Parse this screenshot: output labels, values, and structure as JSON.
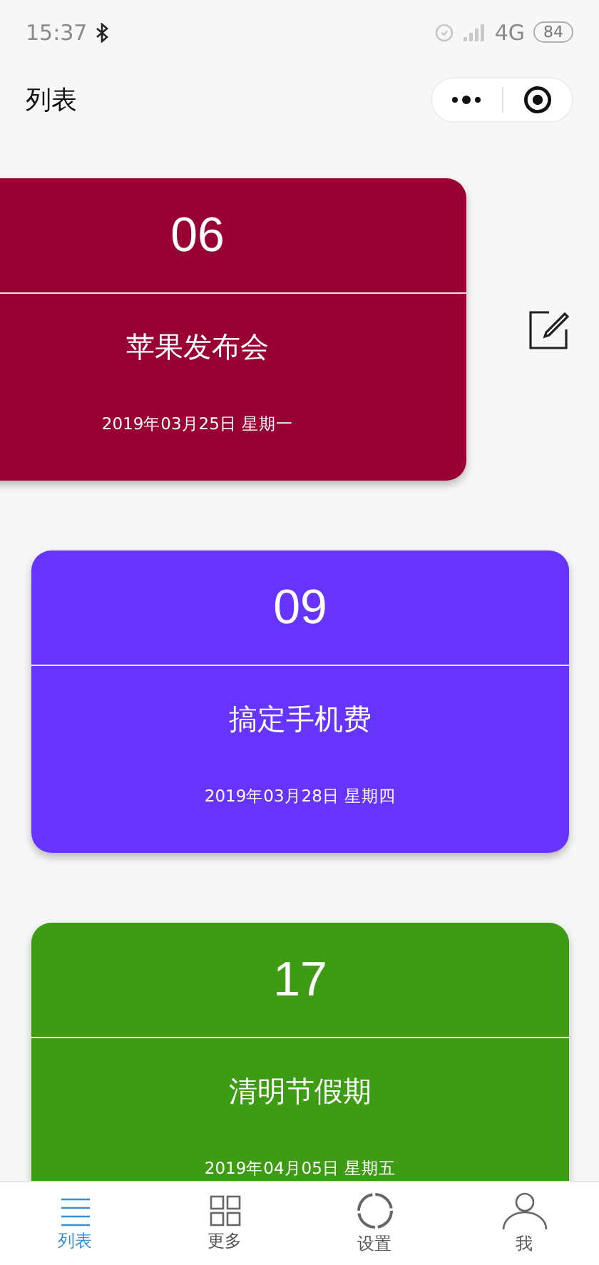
{
  "status_bar": {
    "time": "15:37",
    "network": "4G",
    "battery": "84"
  },
  "header": {
    "title": "列表"
  },
  "cards": [
    {
      "number": "06",
      "title": "苹果发布会",
      "date": "2019年03月25日 星期一",
      "color": "#990033",
      "swiped": true
    },
    {
      "number": "09",
      "title": "搞定手机费",
      "date": "2019年03月28日 星期四",
      "color": "#6633ff",
      "swiped": false
    },
    {
      "number": "17",
      "title": "清明节假期",
      "date": "2019年04月05日 星期五",
      "color": "#3d9c14",
      "swiped": false
    }
  ],
  "tabs": [
    {
      "label": "列表",
      "selected": true
    },
    {
      "label": "更多",
      "selected": false
    },
    {
      "label": "设置",
      "selected": false
    },
    {
      "label": "我",
      "selected": false
    }
  ]
}
